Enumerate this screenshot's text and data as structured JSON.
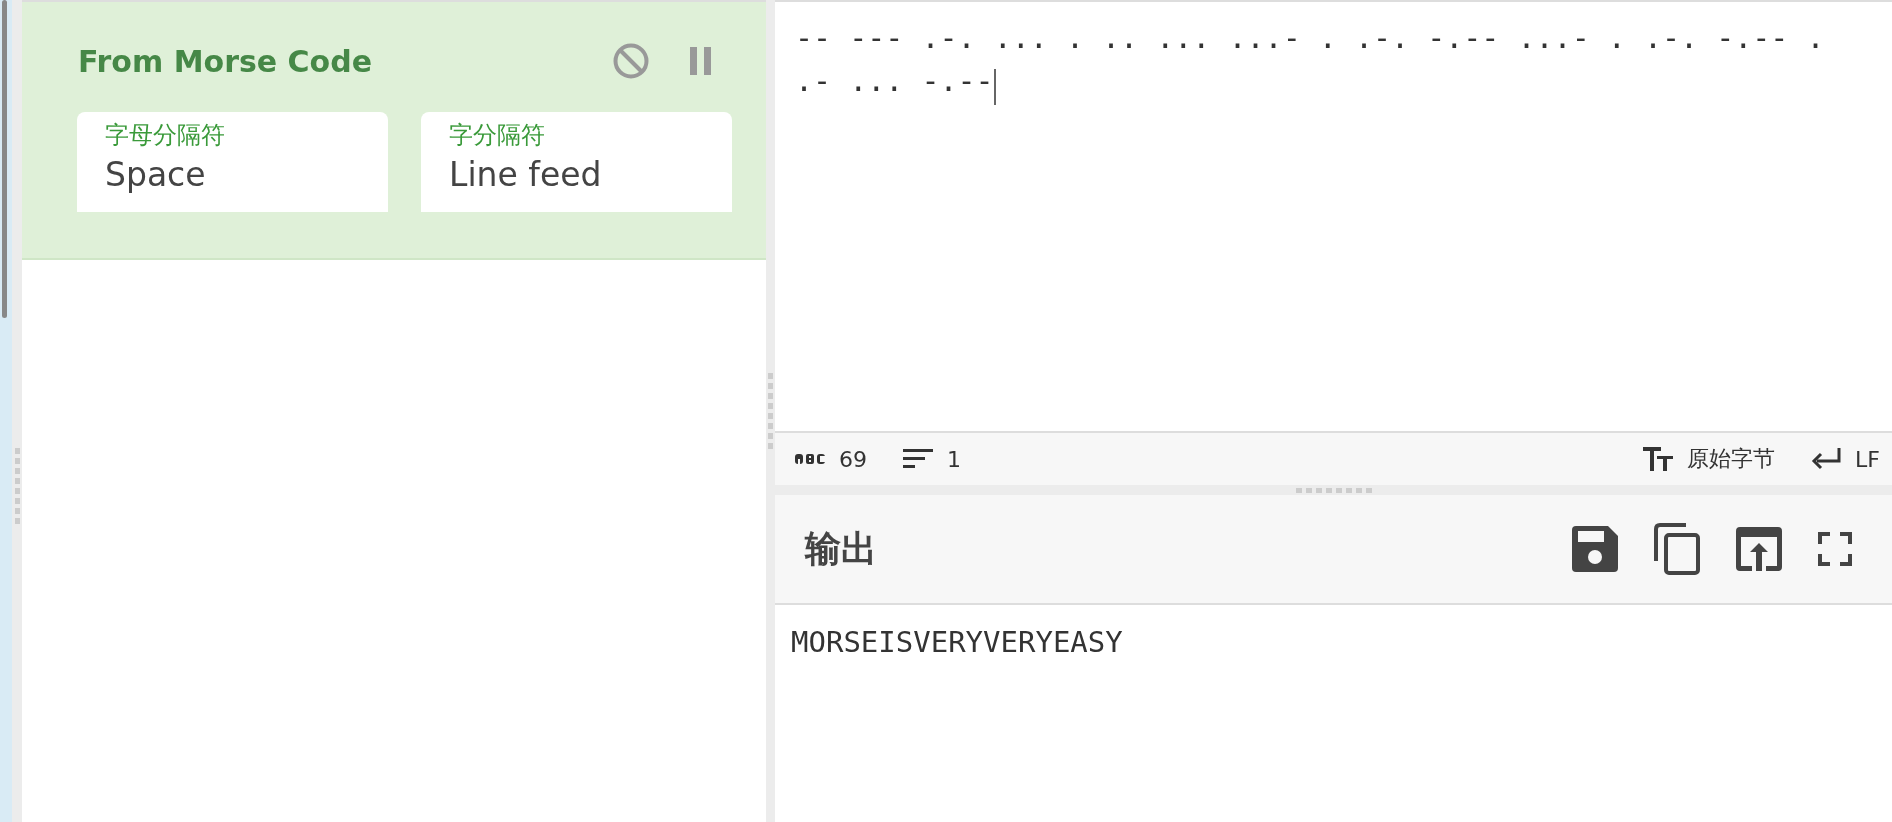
{
  "recipe": {
    "operation": {
      "title": "From Morse Code",
      "args": [
        {
          "label": "字母分隔符",
          "value": "Space"
        },
        {
          "label": "字分隔符",
          "value": "Line feed"
        }
      ]
    }
  },
  "input": {
    "text": "-- --- .-. ... . .. ... ...- . .-. -.-- ...- . .-. -.-- . .- ... -.--"
  },
  "status_bar": {
    "length": "69",
    "lines": "1",
    "encoding": "原始字节",
    "eol": "LF"
  },
  "output": {
    "title": "输出",
    "text": "MORSEISVERYVERYEASY"
  }
}
